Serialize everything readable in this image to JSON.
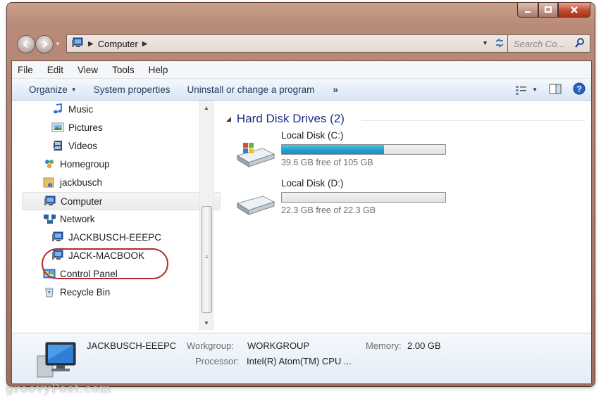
{
  "address": {
    "crumbs": [
      "Computer"
    ],
    "search_placeholder": "Search Co..."
  },
  "menu": [
    "File",
    "Edit",
    "View",
    "Tools",
    "Help"
  ],
  "commands": {
    "organize": "Organize",
    "system_properties": "System properties",
    "uninstall": "Uninstall or change a program",
    "more": "»"
  },
  "tree": [
    {
      "label": "Music",
      "icon": "music-note-icon",
      "indent": 1
    },
    {
      "label": "Pictures",
      "icon": "pictures-icon",
      "indent": 1
    },
    {
      "label": "Videos",
      "icon": "videos-icon",
      "indent": 1
    },
    {
      "label": "Homegroup",
      "icon": "homegroup-icon",
      "indent": 0
    },
    {
      "label": "jackbusch",
      "icon": "user-folder-icon",
      "indent": 0
    },
    {
      "label": "Computer",
      "icon": "computer-icon",
      "indent": 0,
      "selected": true
    },
    {
      "label": "Network",
      "icon": "network-icon",
      "indent": 0
    },
    {
      "label": "JACKBUSCH-EEEPC",
      "icon": "computer-icon",
      "indent": 1
    },
    {
      "label": "JACK-MACBOOK",
      "icon": "computer-icon",
      "indent": 1
    },
    {
      "label": "Control Panel",
      "icon": "control-panel-icon",
      "indent": 0
    },
    {
      "label": "Recycle Bin",
      "icon": "recycle-bin-icon",
      "indent": 0
    }
  ],
  "group": {
    "title": "Hard Disk Drives (2)"
  },
  "drives": [
    {
      "name": "Local Disk (C:)",
      "free_text": "39.6 GB free of 105 GB",
      "used_fraction": 0.623
    },
    {
      "name": "Local Disk (D:)",
      "free_text": "22.3 GB free of 22.3 GB",
      "used_fraction": 0.0
    }
  ],
  "details": {
    "computer_name": "JACKBUSCH-EEEPC",
    "workgroup_label": "Workgroup:",
    "workgroup_value": "WORKGROUP",
    "memory_label": "Memory:",
    "memory_value": "2.00 GB",
    "processor_label": "Processor:",
    "processor_value": "Intel(R) Atom(TM) CPU ..."
  },
  "watermark": "groovyPost.com",
  "colors": {
    "link_blue": "#1e3287",
    "highlight_ring": "#b32a2a",
    "drive_fill": "#23a3cf"
  }
}
